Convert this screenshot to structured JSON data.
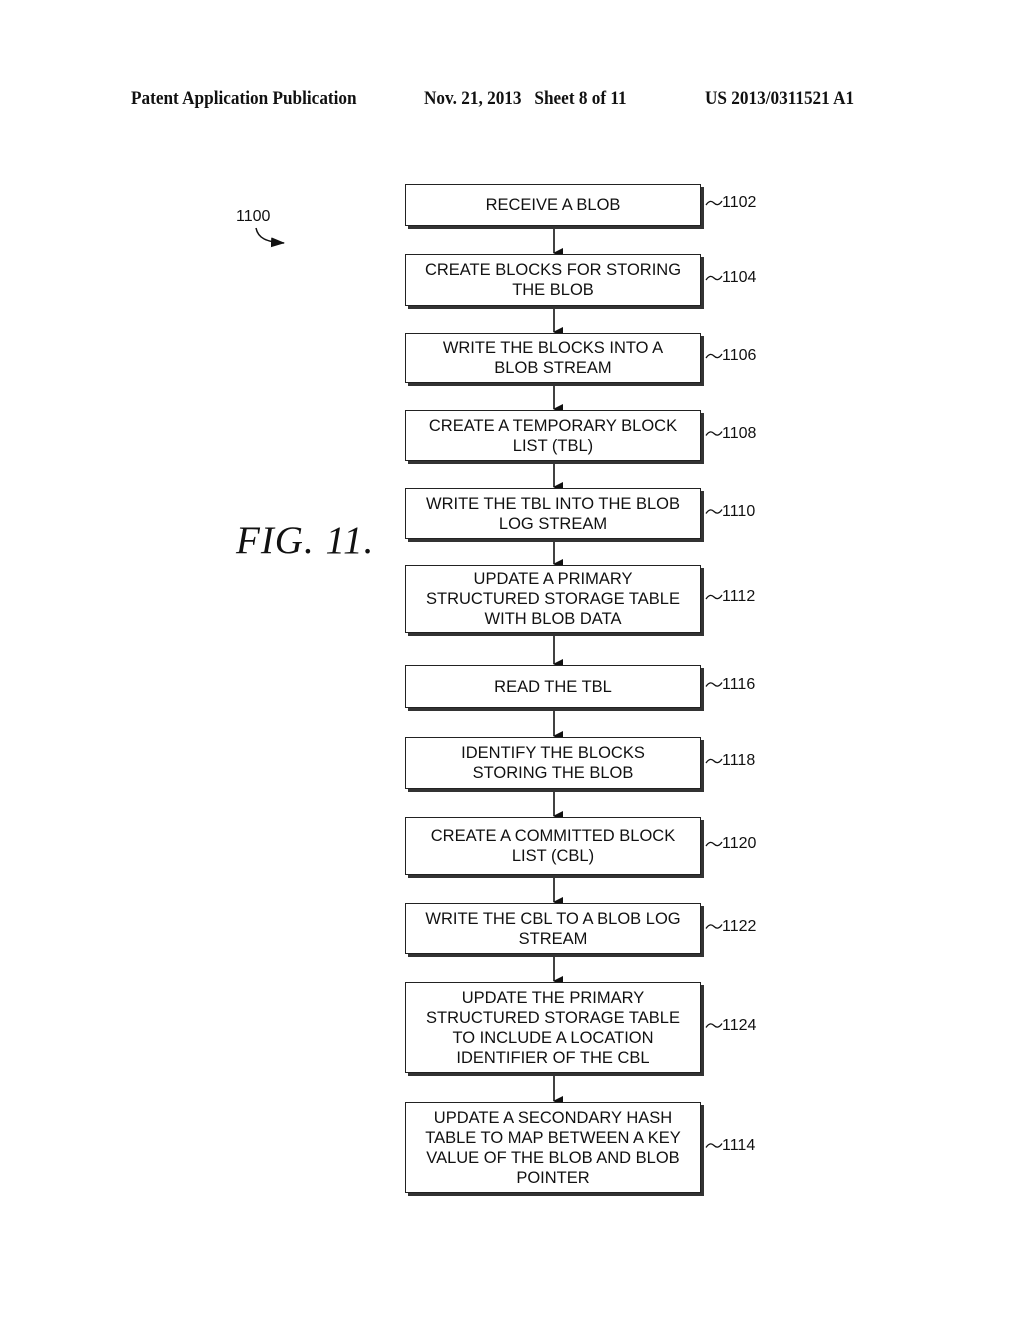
{
  "header": {
    "left": "Patent Application Publication",
    "date_sheet": "Nov. 21, 2013   Sheet 8 of 11",
    "right": "US 2013/0311521 A1"
  },
  "figure": {
    "label": "FIG. 11.",
    "ref": "1100"
  },
  "steps": [
    {
      "id": "1102",
      "text": "RECEIVE A BLOB"
    },
    {
      "id": "1104",
      "text": "CREATE BLOCKS FOR STORING\nTHE BLOB"
    },
    {
      "id": "1106",
      "text": "WRITE THE BLOCKS INTO A\nBLOB STREAM"
    },
    {
      "id": "1108",
      "text": "CREATE A TEMPORARY BLOCK\nLIST (TBL)"
    },
    {
      "id": "1110",
      "text": "WRITE THE TBL INTO THE BLOB\nLOG STREAM"
    },
    {
      "id": "1112",
      "text": "UPDATE A PRIMARY\nSTRUCTURED STORAGE TABLE\nWITH BLOB DATA"
    },
    {
      "id": "1116",
      "text": "READ THE TBL"
    },
    {
      "id": "1118",
      "text": "IDENTIFY THE BLOCKS\nSTORING THE BLOB"
    },
    {
      "id": "1120",
      "text": "CREATE A COMMITTED BLOCK\nLIST (CBL)"
    },
    {
      "id": "1122",
      "text": "WRITE THE CBL TO A BLOB LOG\nSTREAM"
    },
    {
      "id": "1124",
      "text": "UPDATE THE PRIMARY\nSTRUCTURED STORAGE TABLE\nTO INCLUDE A LOCATION\nIDENTIFIER OF THE CBL"
    },
    {
      "id": "1114",
      "text": "UPDATE A SECONDARY HASH\nTABLE TO MAP BETWEEN A KEY\nVALUE OF THE BLOB AND BLOB\nPOINTER"
    }
  ]
}
